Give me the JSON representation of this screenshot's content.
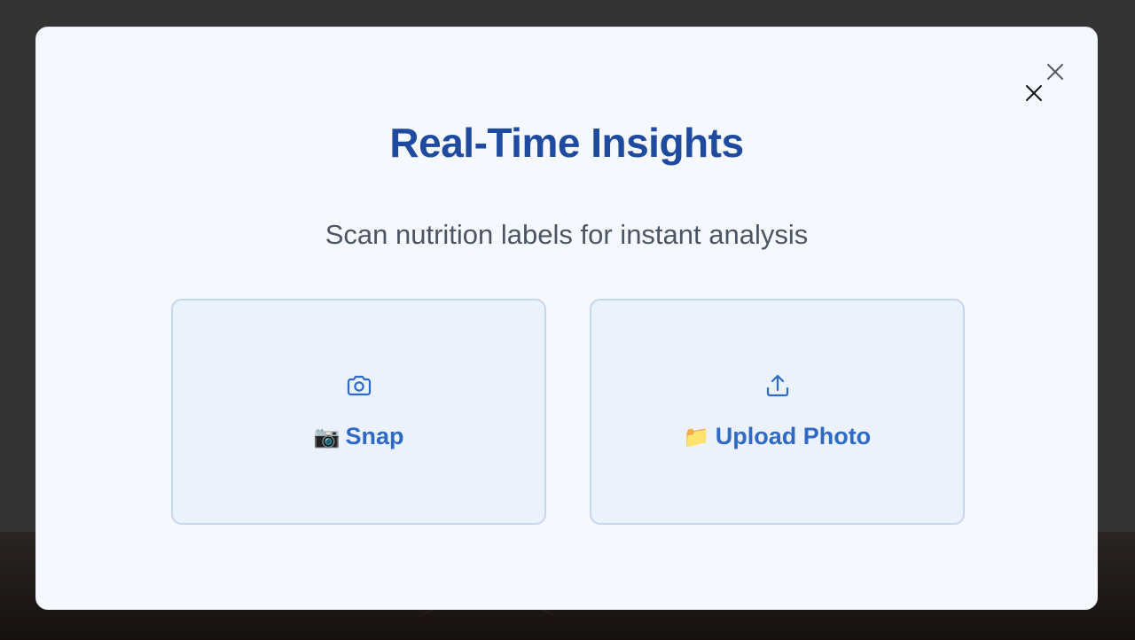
{
  "modal": {
    "title": "Real-Time Insights",
    "subtitle": "Scan nutrition labels for instant analysis",
    "close_icon_name": "close-icon"
  },
  "options": [
    {
      "icon": "camera-icon",
      "emoji": "📷",
      "label": "Snap"
    },
    {
      "icon": "upload-icon",
      "emoji": "📁",
      "label": "Upload Photo"
    }
  ],
  "colors": {
    "overlay": "#333333",
    "modal_bg": "#f5f8fd",
    "title": "#1e4aa0",
    "subtitle": "#4b5563",
    "card_bg": "#ecf2fc",
    "card_border": "#c6d6f1",
    "accent": "#2f6bc4"
  }
}
